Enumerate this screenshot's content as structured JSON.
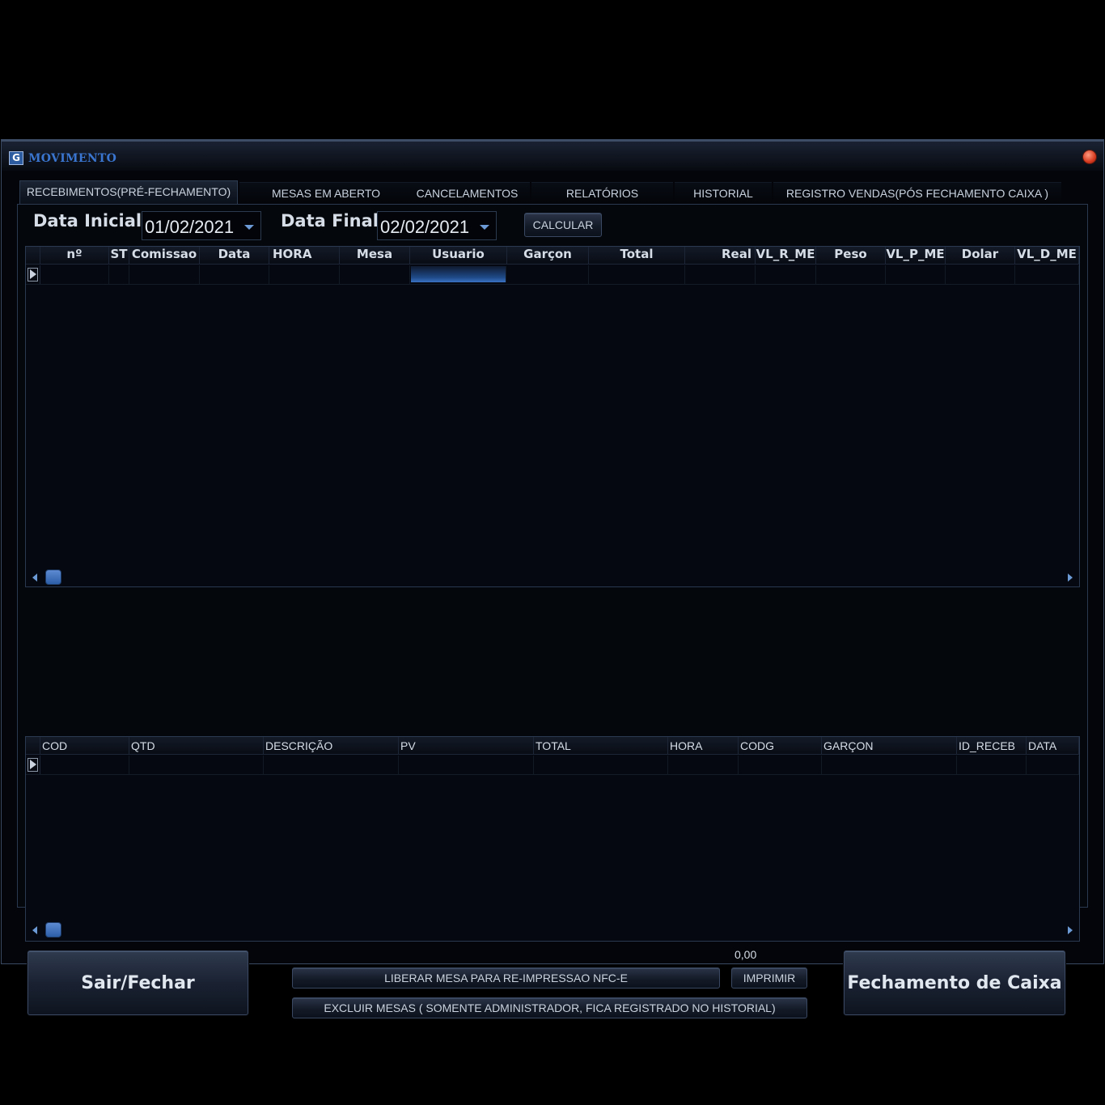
{
  "window": {
    "title": "MOVIMENTO",
    "icon_letter": "G"
  },
  "tabs": [
    {
      "label": "RECEBIMENTOS(PRÉ-FECHAMENTO)",
      "active": true
    },
    {
      "label": "MESAS EM ABERTO",
      "active": false
    },
    {
      "label": "CANCELAMENTOS",
      "active": false
    },
    {
      "label": "RELATÓRIOS",
      "active": false
    },
    {
      "label": "HISTORIAL",
      "active": false
    },
    {
      "label": "REGISTRO VENDAS(PÓS FECHAMENTO CAIXA   )",
      "active": false
    }
  ],
  "filters": {
    "start_label": "Data Inicial",
    "start_value": "01/02/2021",
    "end_label": "Data Final",
    "end_value": "02/02/2021",
    "calculate_label": "CALCULAR"
  },
  "receipts_grid": {
    "columns": [
      "nº",
      "ST",
      "Comissao",
      "Data",
      "HORA",
      "Mesa",
      "Usuario",
      "Garçon",
      "Total",
      "Real",
      "VL_R_ME",
      "Peso",
      "VL_P_ME",
      "Dolar",
      "VL_D_ME"
    ],
    "rows": []
  },
  "items_grid": {
    "columns": [
      "COD",
      "QTD",
      "DESCRIÇÃO",
      "PV",
      "TOTAL",
      "HORA",
      "CODG",
      "GARÇON",
      "ID_RECEB",
      "DATA"
    ],
    "rows": []
  },
  "footer": {
    "exit_label": "Sair/Fechar",
    "release_label": "LIBERAR MESA PARA RE-IMPRESSAO NFC-E",
    "print_label": "IMPRIMIR",
    "delete_label": "EXCLUIR MESAS ( SOMENTE ADMINISTRADOR, FICA REGISTRADO NO HISTORIAL)",
    "amount": "0,00",
    "close_cash_label": "Fechamento de Caixa"
  },
  "colors": {
    "background": "#03050a",
    "accent": "#3a76d0",
    "border": "#2b3950"
  }
}
